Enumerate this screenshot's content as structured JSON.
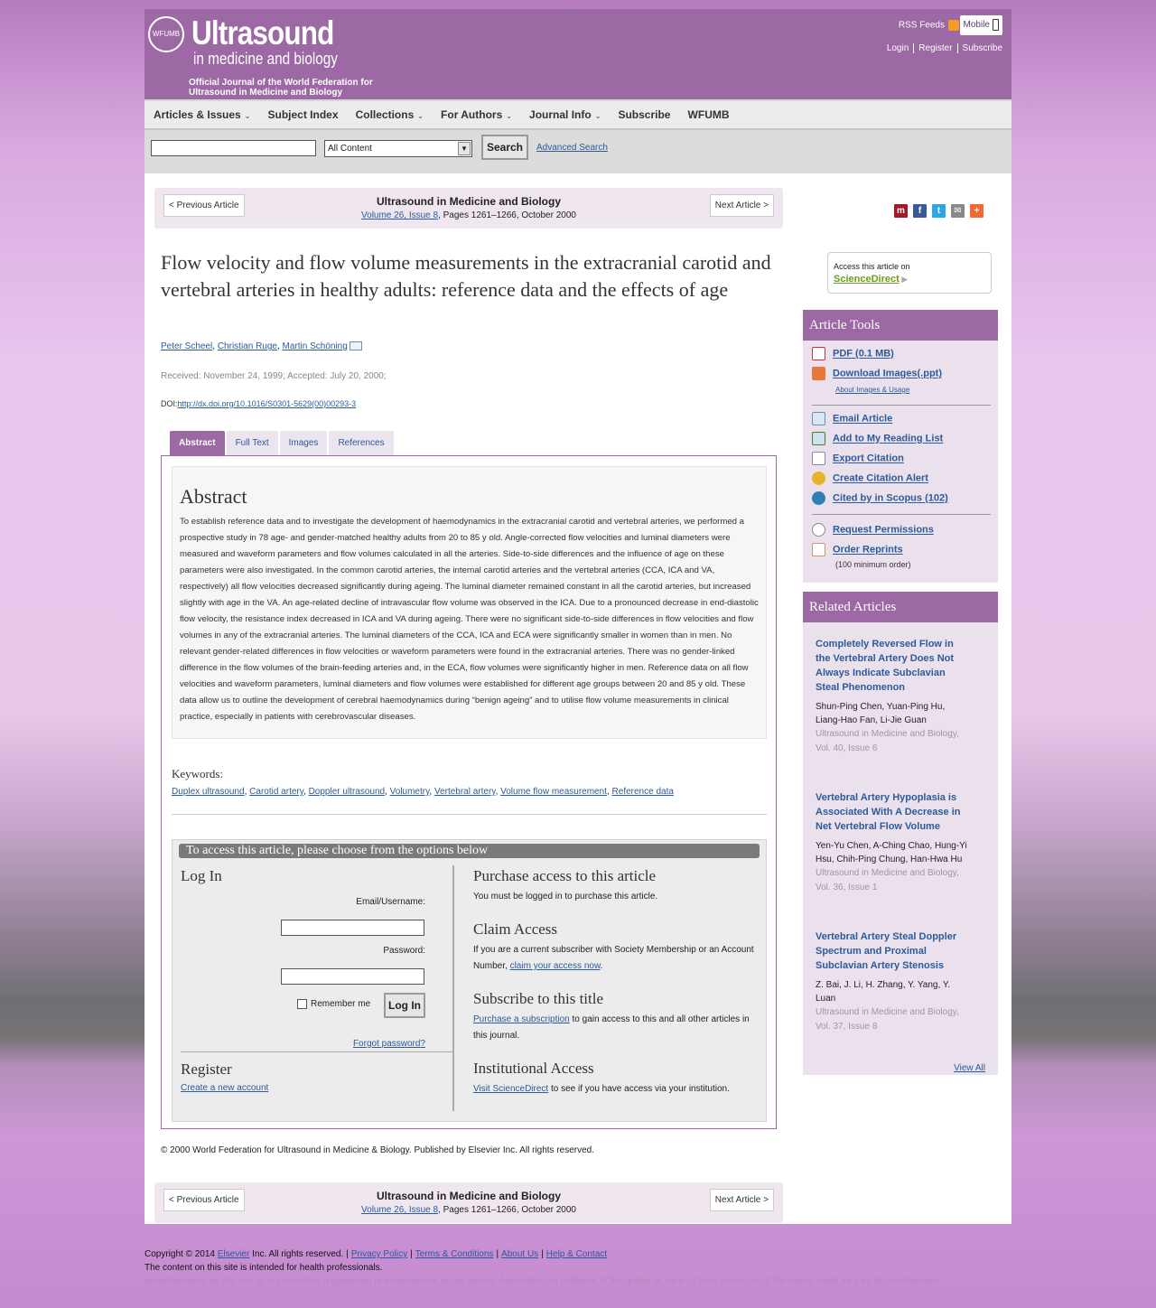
{
  "header": {
    "journal_title": "Ultrasound",
    "journal_subtitle": "in medicine and biology",
    "tagline": "Official Journal of the World Federation for Ultrasound in Medicine and Biology",
    "seal_text": "WFUMB",
    "rss_label": "RSS Feeds",
    "mobile_label": "Mobile",
    "top_links": [
      "Login",
      "Register",
      "Subscribe"
    ]
  },
  "nav": {
    "items": [
      {
        "label": "Articles & Issues",
        "dropdown": true
      },
      {
        "label": "Subject Index",
        "dropdown": false
      },
      {
        "label": "Collections",
        "dropdown": true
      },
      {
        "label": "For Authors",
        "dropdown": true
      },
      {
        "label": "Journal Info",
        "dropdown": true
      },
      {
        "label": "Subscribe",
        "dropdown": false
      },
      {
        "label": "WFUMB",
        "dropdown": false
      }
    ]
  },
  "search": {
    "query": "",
    "scope": "All Content",
    "button": "Search",
    "advanced": "Advanced Search"
  },
  "article_nav": {
    "prev": "< Previous Article",
    "next": "Next Article >",
    "journal": "Ultrasound in Medicine and Biology",
    "volume_link": "Volume 26, Issue 8",
    "pages_date": ", Pages 1261–1266, October 2000"
  },
  "article": {
    "title": "Flow velocity and flow volume measurements in the extracranial carotid and vertebral arteries in healthy adults: reference data and the effects of age",
    "authors": [
      "Peter Scheel",
      "Christian Ruge",
      "Martin Schöning"
    ],
    "received": "Received: November 24, 1999; Accepted: July 20, 2000;",
    "doi_label": "DOI:",
    "doi_url": "http://dx.doi.org/10.1016/S0301-5629(00)00293-3",
    "tabs": [
      "Abstract",
      "Full Text",
      "Images",
      "References"
    ],
    "abstract_heading": "Abstract",
    "abstract_text": "To establish reference data and to investigate the development of haemodynamics in the extracranial carotid and vertebral arteries, we performed a prospective study in 78 age- and gender-matched healthy adults from 20 to 85 y old. Angle-corrected flow velocities and luminal diameters were measured and waveform parameters and flow volumes calculated in all the arteries. Side-to-side differences and the influence of age on these parameters were also investigated. In the common carotid arteries, the internal carotid arteries and the vertebral arteries (CCA, ICA and VA, respectively) all flow velocities decreased significantly during ageing. The luminal diameter remained constant in all the carotid arteries, but increased slightly with age in the VA. An age-related decline of intravascular flow volume was observed in the ICA. Due to a pronounced decrease in end-diastolic flow velocity, the resistance index decreased in ICA and VA during ageing. There were no significant side-to-side differences in flow velocities and flow volumes in any of the extracranial arteries. The luminal diameters of the CCA, ICA and ECA were significantly smaller in women than in men. No relevant gender-related differences in flow velocities or waveform parameters were found in the extracranial arteries. There was no gender-linked difference in the flow volumes of the brain-feeding arteries and, in the ECA, flow volumes were significantly higher in men. Reference data on all flow velocities and waveform parameters, luminal diameters and flow volumes were established for different age groups between 20 and 85 y old. These data allow us to outline the development of cerebral haemodynamics during “benign ageing” and to utilise flow volume measurements in clinical practice, especially in patients with cerebrovascular diseases.",
    "keywords_label": "Keywords:",
    "keywords": [
      "Duplex ultrasound",
      "Carotid artery",
      "Doppler ultrasound",
      "Volumetry",
      "Vertebral artery",
      "Volume flow measurement",
      "Reference data"
    ],
    "copyright": "© 2000 World Federation for Ultrasound in Medicine & Biology. Published by Elsevier Inc. All rights reserved."
  },
  "access": {
    "heading": "To access this article, please choose from the options below",
    "login_heading": "Log In",
    "email_label": "Email/Username:",
    "password_label": "Password:",
    "remember_label": "Remember me",
    "login_button": "Log In",
    "forgot": "Forgot password?",
    "register_heading": "Register",
    "register_link": "Create a new account",
    "purchase_heading": "Purchase access to this article",
    "purchase_text": "You must be logged in to purchase this article.",
    "claim_heading": "Claim Access",
    "claim_text": "If you are a current subscriber with Society Membership or an Account Number,",
    "claim_link": "claim your access now",
    "subscribe_heading": "Subscribe to this title",
    "subscribe_link": "Purchase a subscription",
    "subscribe_text": " to gain access to this and all other articles in this journal.",
    "institution_heading": "Institutional Access",
    "institution_link": "Visit ScienceDirect",
    "institution_text": " to see if you have access via your institution."
  },
  "sidebar": {
    "sciencedirect_text": "Access this article on",
    "sciencedirect_link": "ScienceDirect",
    "tools_heading": "Article Tools",
    "pdf": "PDF (0.1 MB)",
    "download_images": "Download Images(.ppt)",
    "about_images": "About Images & Usage",
    "email_article": "Email Article",
    "reading_list": "Add to My Reading List",
    "export_citation": "Export Citation",
    "citation_alert": "Create Citation Alert",
    "cited_by": "Cited by in Scopus (102)",
    "permissions": "Request Permissions",
    "reprints": "Order Reprints",
    "reprints_note": "(100 minimum order)",
    "related_heading": "Related Articles",
    "related": [
      {
        "title": "Completely Reversed Flow in the Vertebral Artery Does Not Always Indicate Subclavian Steal Phenomenon",
        "authors": "Shun-Ping Chen, Yuan-Ping Hu, Liang-Hao Fan, Li-Jie Guan",
        "journal": "Ultrasound in Medicine and Biology, Vol. 40, Issue 6"
      },
      {
        "title": "Vertebral Artery Hypoplasia is Associated With A Decrease in Net Vertebral Flow Volume",
        "authors": "Yen-Yu Chen, A-Ching Chao, Hung-Yi Hsu, Chih-Ping Chung, Han-Hwa Hu",
        "journal": "Ultrasound in Medicine and Biology, Vol. 36, Issue 1"
      },
      {
        "title": "Vertebral Artery Steal Doppler Spectrum and Proximal Subclavian Artery Stenosis",
        "authors": "Z. Bai, J. Li, H. Zhang, Y. Yang, Y. Luan",
        "journal": "Ultrasound in Medicine and Biology, Vol. 37, Issue 8"
      }
    ],
    "view_all": "View All"
  },
  "footer": {
    "copyright_pre": "Copyright © 2014",
    "elsevier": "Elsevier",
    "copyright_post": "Inc. All rights reserved.",
    "links": [
      "Privacy Policy",
      "Terms & Conditions",
      "About Us",
      "Help & Contact"
    ],
    "health_note": "The content on this site is intended for health professionals.",
    "disclaimer": "Advertisements on this site do not constitute a guarantee or endorsement by the journal, Association, or publisher of the quality or value of such product or of the claims made for it by its manufacturer."
  },
  "colors": {
    "brand_purple": "#9c69a4",
    "link_blue": "#2b5b9a",
    "sciencedirect_green": "#6d9c1f"
  },
  "icons": {
    "rss": "rss-icon",
    "mobile": "mobile-phone-icon",
    "mail": "mail-icon",
    "share": [
      "mendeley-icon",
      "facebook-icon",
      "twitter-icon",
      "email-share-icon",
      "more-share-icon"
    ]
  }
}
